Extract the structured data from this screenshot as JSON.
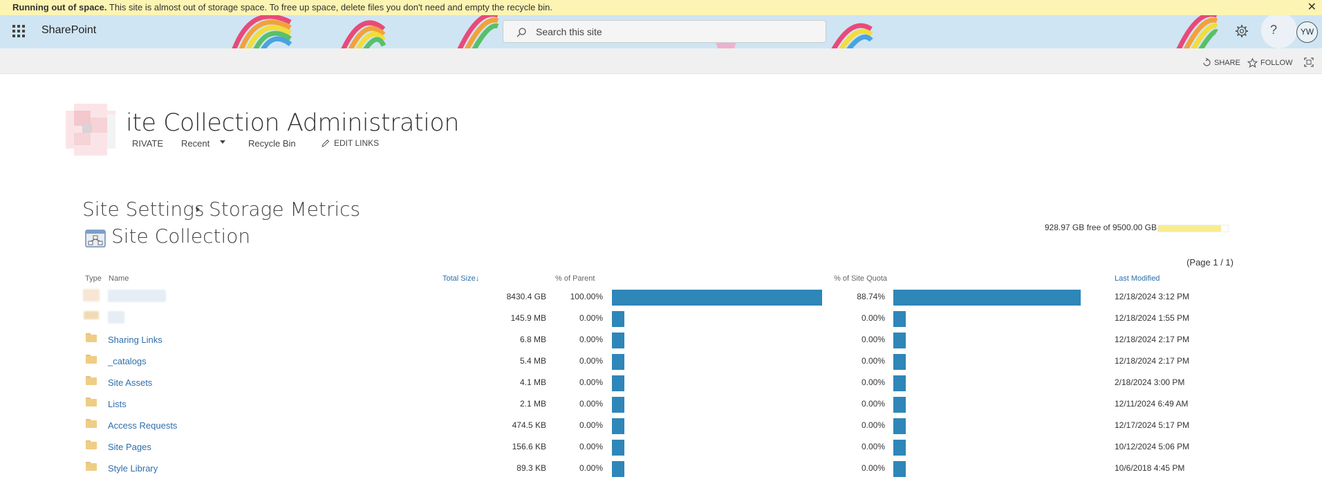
{
  "banner": {
    "bold": "Running out of space.",
    "text": " This site is almost out of storage space. To free up space, delete files you don't need and empty the recycle bin.",
    "close": "✕"
  },
  "suitebar": {
    "brand": "SharePoint",
    "search_placeholder": "Search this site",
    "help": "?",
    "avatar": "YW"
  },
  "ribbon": {
    "share": "SHARE",
    "follow": "FOLLOW"
  },
  "site": {
    "title": "ite Collection Administration",
    "nav": {
      "private": "RIVATE",
      "recent": "Recent",
      "recycle": "Recycle Bin",
      "edit_links": "EDIT LINKS"
    }
  },
  "page": {
    "breadcrumb_1": "Site Settings",
    "breadcrumb_2": "Storage Metrics",
    "section_title": "Site Collection",
    "quota_text": "928.97 GB free of 9500.00 GB",
    "quota_used_fraction": 0.902,
    "page_indicator": "(Page 1 / 1)"
  },
  "table": {
    "headers": {
      "type": "Type",
      "name": "Name",
      "total_size": "Total Size",
      "pct_parent": "% of Parent",
      "pct_quota": "% of Site Quota",
      "last_modified": "Last Modified"
    },
    "rows": [
      {
        "name": "",
        "size": "8430.4 GB",
        "pct_parent": "100.00%",
        "parent_fraction": 1.0,
        "pct_quota": "88.74%",
        "quota_fraction": 0.8874,
        "modified": "12/18/2024 3:12 PM"
      },
      {
        "name": "",
        "size": "145.9 MB",
        "pct_parent": "0.00%",
        "parent_fraction": 0.0,
        "pct_quota": "0.00%",
        "quota_fraction": 0.0,
        "modified": "12/18/2024 1:55 PM"
      },
      {
        "name": "Sharing Links",
        "size": "6.8 MB",
        "pct_parent": "0.00%",
        "parent_fraction": 0.0,
        "pct_quota": "0.00%",
        "quota_fraction": 0.0,
        "modified": "12/18/2024 2:17 PM"
      },
      {
        "name": "_catalogs",
        "size": "5.4 MB",
        "pct_parent": "0.00%",
        "parent_fraction": 0.0,
        "pct_quota": "0.00%",
        "quota_fraction": 0.0,
        "modified": "12/18/2024 2:17 PM"
      },
      {
        "name": "Site Assets",
        "size": "4.1 MB",
        "pct_parent": "0.00%",
        "parent_fraction": 0.0,
        "pct_quota": "0.00%",
        "quota_fraction": 0.0,
        "modified": "2/18/2024 3:00 PM"
      },
      {
        "name": "Lists",
        "size": "2.1 MB",
        "pct_parent": "0.00%",
        "parent_fraction": 0.0,
        "pct_quota": "0.00%",
        "quota_fraction": 0.0,
        "modified": "12/11/2024 6:49 AM"
      },
      {
        "name": "Access Requests",
        "size": "474.5 KB",
        "pct_parent": "0.00%",
        "parent_fraction": 0.0,
        "pct_quota": "0.00%",
        "quota_fraction": 0.0,
        "modified": "12/17/2024 5:17 PM"
      },
      {
        "name": "Site Pages",
        "size": "156.6 KB",
        "pct_parent": "0.00%",
        "parent_fraction": 0.0,
        "pct_quota": "0.00%",
        "quota_fraction": 0.0,
        "modified": "10/12/2024 5:06 PM"
      },
      {
        "name": "Style Library",
        "size": "89.3 KB",
        "pct_parent": "0.00%",
        "parent_fraction": 0.0,
        "pct_quota": "0.00%",
        "quota_fraction": 0.0,
        "modified": "10/6/2018 4:45 PM"
      }
    ]
  },
  "colors": {
    "bar": "#2f86b8",
    "banner": "#fcf4b3",
    "link": "#2e6eab",
    "quota_fill": "#f7ec92"
  }
}
